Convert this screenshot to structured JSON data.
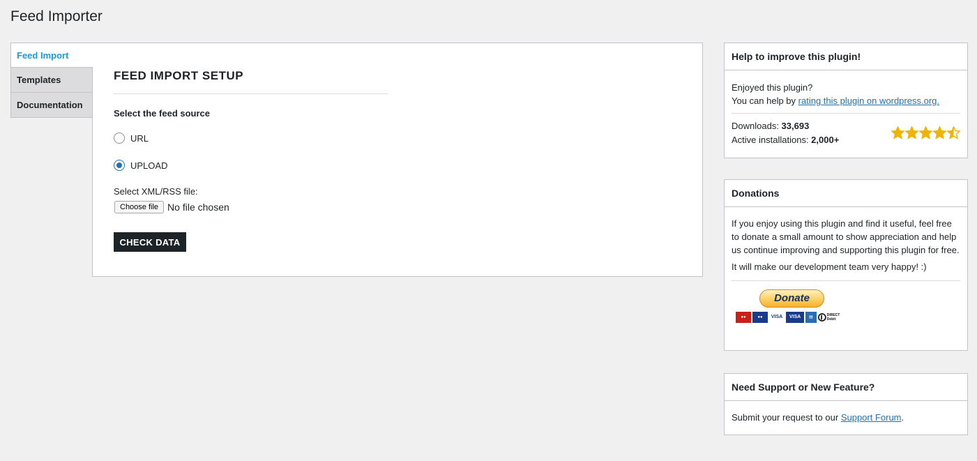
{
  "page": {
    "title": "Feed Importer"
  },
  "tabs": [
    {
      "label": "Feed Import",
      "active": true
    },
    {
      "label": "Templates",
      "active": false
    },
    {
      "label": "Documentation",
      "active": false
    }
  ],
  "setup": {
    "title": "FEED IMPORT SETUP",
    "source_label": "Select the feed source",
    "options": [
      {
        "label": "URL",
        "checked": false
      },
      {
        "label": "UPLOAD",
        "checked": true
      }
    ],
    "file_label": "Select XML/RSS file:",
    "choose_file_label": "Choose file",
    "no_file_text": "No file chosen",
    "check_button": "CHECK DATA"
  },
  "help_box": {
    "title": "Help to improve this plugin!",
    "line1": "Enjoyed this plugin?",
    "line2_prefix": "You can help by ",
    "rating_link": "rating this plugin on wordpress.org.",
    "downloads_label": "Downloads: ",
    "downloads_value": "33,693",
    "installs_label": "Active installations: ",
    "installs_value": "2,000+",
    "rating": 4.5,
    "rating_max": 5
  },
  "donations_box": {
    "title": "Donations",
    "text": "If you enjoy using this plugin and find it useful, feel free to donate a small amount to show appreciation and help us continue improving and supporting this plugin for free.",
    "text2": "It will make our development team very happy! :)",
    "donate_button": "Donate",
    "card_icons": [
      "mastercard-icon",
      "maestro-icon",
      "visa-icon",
      "visa-electron-icon",
      "amex-icon",
      "direct-debit-icon"
    ],
    "direct_debit": "DIRECT Debit"
  },
  "support_box": {
    "title": "Need Support or New Feature?",
    "text_prefix": "Submit your request to our ",
    "link": "Support Forum",
    "text_suffix": "."
  },
  "colors": {
    "accent": "#2271b1",
    "active_tab": "#1a9cd0",
    "star": "#f0b400",
    "button_dark": "#1d2327",
    "background": "#f0f0f1"
  }
}
